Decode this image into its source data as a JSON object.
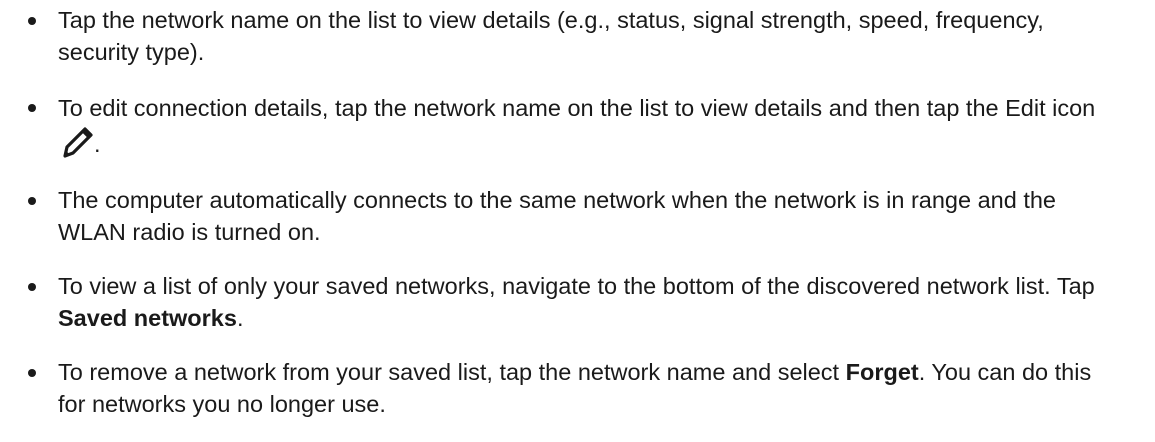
{
  "bullets": [
    {
      "text": "Tap the network name on the list to view details (e.g., status, signal strength, speed, frequency, security type)."
    },
    {
      "text_before_icon": "To edit connection details, tap the network name on the list to view details and then tap the Edit icon",
      "icon": "edit-pencil-icon",
      "text_after_icon": "."
    },
    {
      "text": "The computer automatically connects to the same network when the network is in range and the WLAN radio is turned on."
    },
    {
      "text_before_bold": "To view a list of only your saved networks, navigate to the bottom of the discovered network list. Tap",
      "bold": "Saved networks",
      "text_after_bold": "."
    },
    {
      "text_before_bold": "To remove a network from your saved list, tap the network name and select",
      "bold": "Forget",
      "text_after_bold": ". You can do this for networks you no longer use."
    }
  ]
}
